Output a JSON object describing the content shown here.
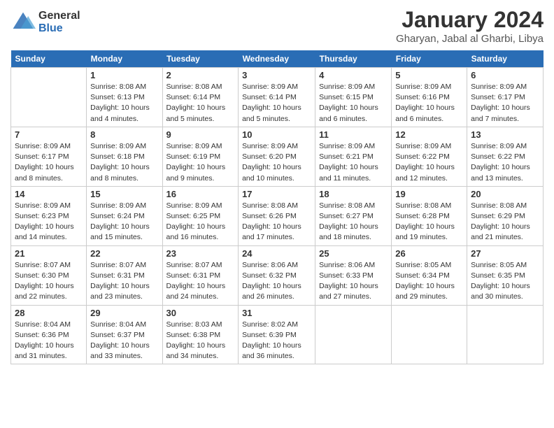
{
  "logo": {
    "general": "General",
    "blue": "Blue"
  },
  "title": "January 2024",
  "subtitle": "Gharyan, Jabal al Gharbi, Libya",
  "headers": [
    "Sunday",
    "Monday",
    "Tuesday",
    "Wednesday",
    "Thursday",
    "Friday",
    "Saturday"
  ],
  "weeks": [
    [
      {
        "date": "",
        "info": ""
      },
      {
        "date": "1",
        "info": "Sunrise: 8:08 AM\nSunset: 6:13 PM\nDaylight: 10 hours\nand 4 minutes."
      },
      {
        "date": "2",
        "info": "Sunrise: 8:08 AM\nSunset: 6:14 PM\nDaylight: 10 hours\nand 5 minutes."
      },
      {
        "date": "3",
        "info": "Sunrise: 8:09 AM\nSunset: 6:14 PM\nDaylight: 10 hours\nand 5 minutes."
      },
      {
        "date": "4",
        "info": "Sunrise: 8:09 AM\nSunset: 6:15 PM\nDaylight: 10 hours\nand 6 minutes."
      },
      {
        "date": "5",
        "info": "Sunrise: 8:09 AM\nSunset: 6:16 PM\nDaylight: 10 hours\nand 6 minutes."
      },
      {
        "date": "6",
        "info": "Sunrise: 8:09 AM\nSunset: 6:17 PM\nDaylight: 10 hours\nand 7 minutes."
      }
    ],
    [
      {
        "date": "7",
        "info": "Sunrise: 8:09 AM\nSunset: 6:17 PM\nDaylight: 10 hours\nand 8 minutes."
      },
      {
        "date": "8",
        "info": "Sunrise: 8:09 AM\nSunset: 6:18 PM\nDaylight: 10 hours\nand 8 minutes."
      },
      {
        "date": "9",
        "info": "Sunrise: 8:09 AM\nSunset: 6:19 PM\nDaylight: 10 hours\nand 9 minutes."
      },
      {
        "date": "10",
        "info": "Sunrise: 8:09 AM\nSunset: 6:20 PM\nDaylight: 10 hours\nand 10 minutes."
      },
      {
        "date": "11",
        "info": "Sunrise: 8:09 AM\nSunset: 6:21 PM\nDaylight: 10 hours\nand 11 minutes."
      },
      {
        "date": "12",
        "info": "Sunrise: 8:09 AM\nSunset: 6:22 PM\nDaylight: 10 hours\nand 12 minutes."
      },
      {
        "date": "13",
        "info": "Sunrise: 8:09 AM\nSunset: 6:22 PM\nDaylight: 10 hours\nand 13 minutes."
      }
    ],
    [
      {
        "date": "14",
        "info": "Sunrise: 8:09 AM\nSunset: 6:23 PM\nDaylight: 10 hours\nand 14 minutes."
      },
      {
        "date": "15",
        "info": "Sunrise: 8:09 AM\nSunset: 6:24 PM\nDaylight: 10 hours\nand 15 minutes."
      },
      {
        "date": "16",
        "info": "Sunrise: 8:09 AM\nSunset: 6:25 PM\nDaylight: 10 hours\nand 16 minutes."
      },
      {
        "date": "17",
        "info": "Sunrise: 8:08 AM\nSunset: 6:26 PM\nDaylight: 10 hours\nand 17 minutes."
      },
      {
        "date": "18",
        "info": "Sunrise: 8:08 AM\nSunset: 6:27 PM\nDaylight: 10 hours\nand 18 minutes."
      },
      {
        "date": "19",
        "info": "Sunrise: 8:08 AM\nSunset: 6:28 PM\nDaylight: 10 hours\nand 19 minutes."
      },
      {
        "date": "20",
        "info": "Sunrise: 8:08 AM\nSunset: 6:29 PM\nDaylight: 10 hours\nand 21 minutes."
      }
    ],
    [
      {
        "date": "21",
        "info": "Sunrise: 8:07 AM\nSunset: 6:30 PM\nDaylight: 10 hours\nand 22 minutes."
      },
      {
        "date": "22",
        "info": "Sunrise: 8:07 AM\nSunset: 6:31 PM\nDaylight: 10 hours\nand 23 minutes."
      },
      {
        "date": "23",
        "info": "Sunrise: 8:07 AM\nSunset: 6:31 PM\nDaylight: 10 hours\nand 24 minutes."
      },
      {
        "date": "24",
        "info": "Sunrise: 8:06 AM\nSunset: 6:32 PM\nDaylight: 10 hours\nand 26 minutes."
      },
      {
        "date": "25",
        "info": "Sunrise: 8:06 AM\nSunset: 6:33 PM\nDaylight: 10 hours\nand 27 minutes."
      },
      {
        "date": "26",
        "info": "Sunrise: 8:05 AM\nSunset: 6:34 PM\nDaylight: 10 hours\nand 29 minutes."
      },
      {
        "date": "27",
        "info": "Sunrise: 8:05 AM\nSunset: 6:35 PM\nDaylight: 10 hours\nand 30 minutes."
      }
    ],
    [
      {
        "date": "28",
        "info": "Sunrise: 8:04 AM\nSunset: 6:36 PM\nDaylight: 10 hours\nand 31 minutes."
      },
      {
        "date": "29",
        "info": "Sunrise: 8:04 AM\nSunset: 6:37 PM\nDaylight: 10 hours\nand 33 minutes."
      },
      {
        "date": "30",
        "info": "Sunrise: 8:03 AM\nSunset: 6:38 PM\nDaylight: 10 hours\nand 34 minutes."
      },
      {
        "date": "31",
        "info": "Sunrise: 8:02 AM\nSunset: 6:39 PM\nDaylight: 10 hours\nand 36 minutes."
      },
      {
        "date": "",
        "info": ""
      },
      {
        "date": "",
        "info": ""
      },
      {
        "date": "",
        "info": ""
      }
    ]
  ]
}
